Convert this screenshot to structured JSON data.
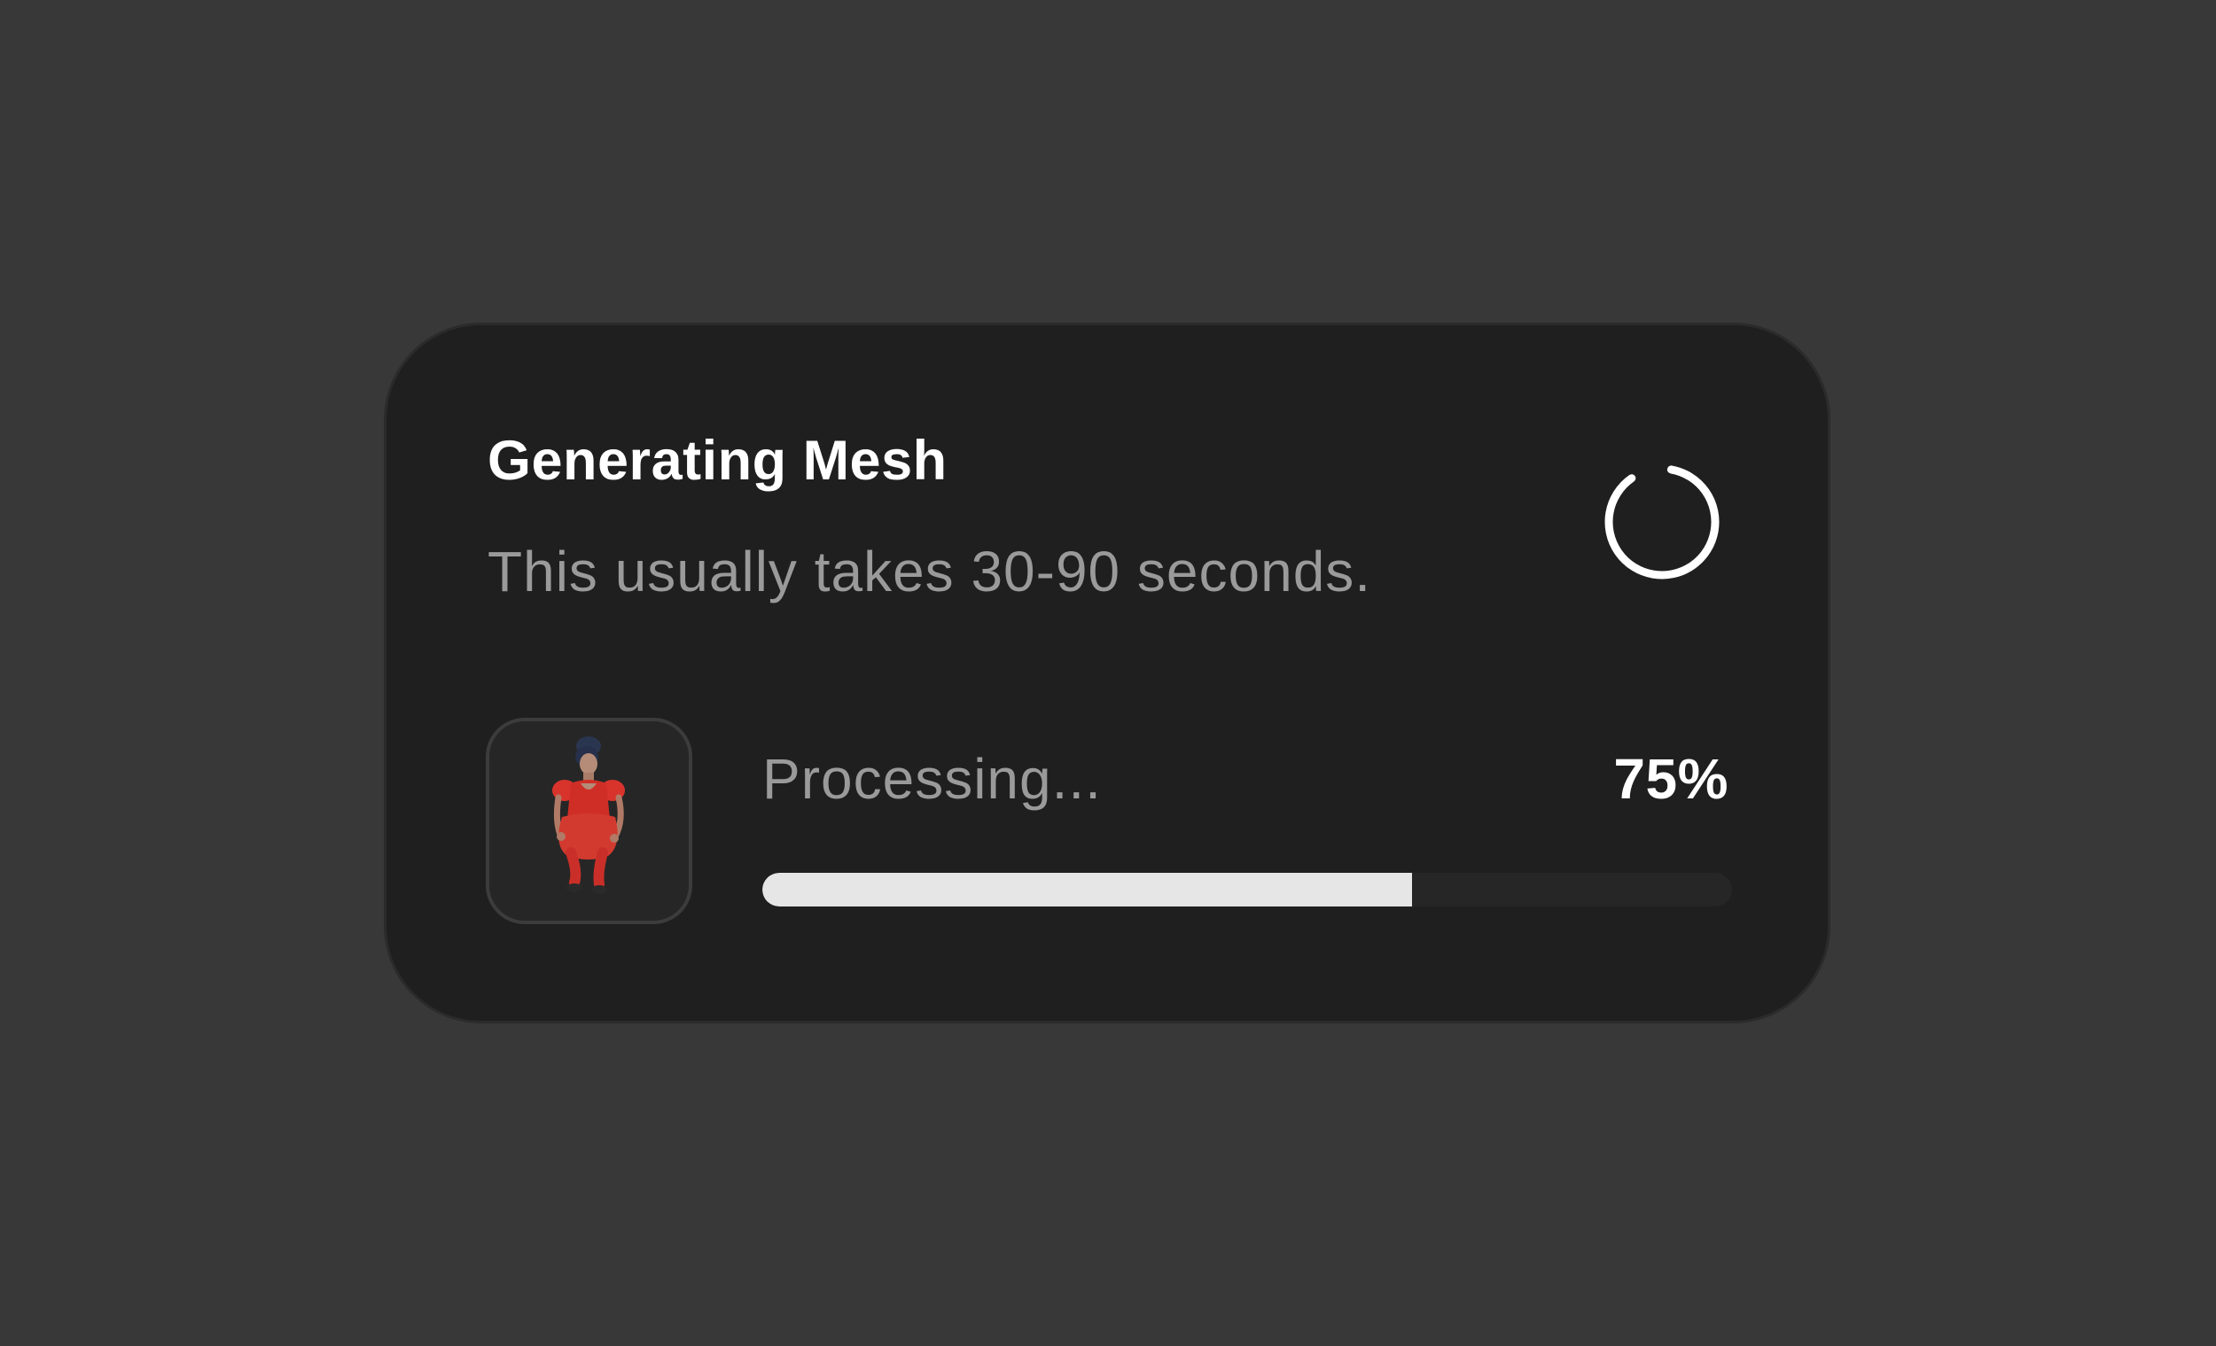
{
  "dialog": {
    "title": "Generating Mesh",
    "subtitle": "This usually takes 30-90 seconds."
  },
  "spinner": {
    "icon": "loading-spinner-icon",
    "color": "#ffffff"
  },
  "progress": {
    "label": "Processing...",
    "percent_text": "75%",
    "value": 0.67,
    "fill_color": "#e6e6e6",
    "track_color": "#262626"
  },
  "thumbnail": {
    "icon": "model-preview-icon",
    "accent": "#d8342c"
  },
  "colors": {
    "background": "#383838",
    "card": "#1f1f1f",
    "muted_text": "#9a9a9a",
    "primary_text": "#ffffff"
  }
}
